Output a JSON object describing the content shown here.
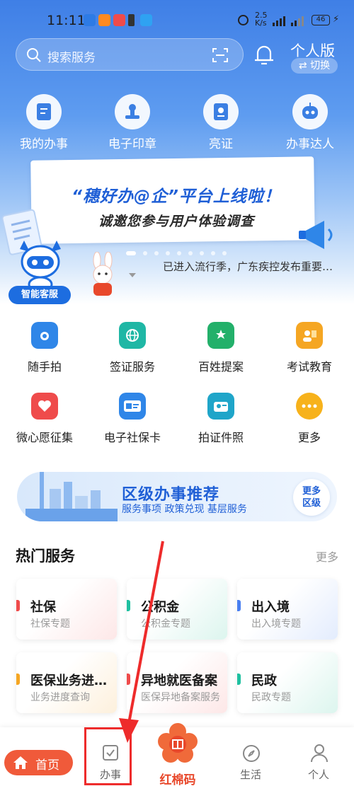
{
  "status_bar": {
    "time": "11:11",
    "network_speed": "2.5\nK/s",
    "network_speed_top": "2.5",
    "network_speed_bottom": "K/s",
    "battery": "46"
  },
  "header": {
    "search_placeholder": "搜索服务",
    "persona_label": "个人版",
    "switch_label": "切换"
  },
  "top_nav": [
    {
      "label": "我的办事",
      "icon": "document-icon"
    },
    {
      "label": "电子印章",
      "icon": "stamp-icon"
    },
    {
      "label": "亮证",
      "icon": "certificate-icon"
    },
    {
      "label": "办事达人",
      "icon": "robot-icon"
    }
  ],
  "banner": {
    "line1": "“穗好办@企”平台上线啦！",
    "line2": "诚邀您参与用户体验调查"
  },
  "ticker_text": "已进入流行季，广东疾控发布重要…",
  "assistant_label": "智能客服",
  "grid": [
    {
      "label": "随手拍",
      "icon": "camera-icon",
      "color": "#2f86e8"
    },
    {
      "label": "签证服务",
      "icon": "globe-icon",
      "color": "#1fb7a5"
    },
    {
      "label": "百姓提案",
      "icon": "proposal-icon",
      "color": "#23b06a"
    },
    {
      "label": "考试教育",
      "icon": "education-icon",
      "color": "#f5a623"
    },
    {
      "label": "微心愿征集",
      "icon": "heart-icon",
      "color": "#ef4b4b"
    },
    {
      "label": "电子社保卡",
      "icon": "card-icon",
      "color": "#2f86e8"
    },
    {
      "label": "拍证件照",
      "icon": "id-photo-icon",
      "color": "#1fa5c9"
    },
    {
      "label": "更多",
      "icon": "more-icon",
      "color": "#f7b21b"
    }
  ],
  "district": {
    "title": "区级办事推荐",
    "subtitle": "服务事项  政策兑现  基层服务",
    "more_line1": "更多",
    "more_line2": "区级"
  },
  "hot_services": {
    "title": "热门服务",
    "more": "更多",
    "items": [
      {
        "title": "社保",
        "subtitle": "社保专题",
        "accent": "#ef4b4b"
      },
      {
        "title": "公积金",
        "subtitle": "公积金专题",
        "accent": "#1fc0a0"
      },
      {
        "title": "出入境",
        "subtitle": "出入境专题",
        "accent": "#4a7ff0"
      },
      {
        "title": "医保业务进…",
        "subtitle": "业务进度查询",
        "accent": "#f5a623"
      },
      {
        "title": "异地就医备案",
        "subtitle": "医保异地备案服务",
        "accent": "#ef4b4b"
      },
      {
        "title": "民政",
        "subtitle": "民政专题",
        "accent": "#1fc0a0"
      }
    ]
  },
  "bottom_nav": {
    "home": "首页",
    "tasks": "办事",
    "center": "红棉码",
    "life": "生活",
    "personal": "个人"
  }
}
